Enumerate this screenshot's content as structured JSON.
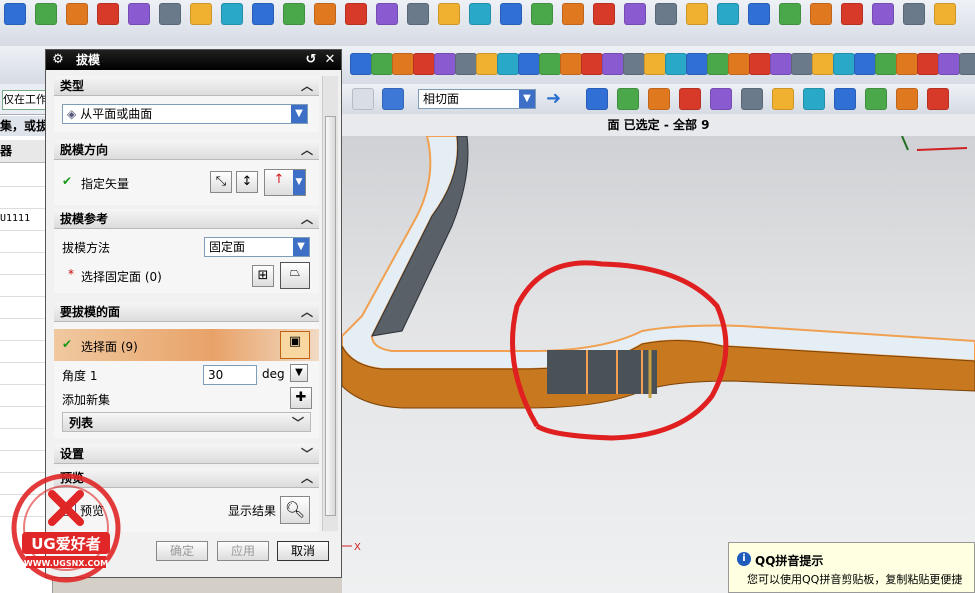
{
  "toolbar": {
    "filter_value": "仅在工作",
    "face_rule_value": "相切面"
  },
  "navigator": {
    "hint_text": "集，或拔",
    "column_header": "器",
    "rows": [
      "",
      "",
      "U1111",
      "",
      "",
      "",
      "",
      "",
      "",
      "",
      "",
      "",
      "",
      "",
      "",
      ""
    ]
  },
  "status": {
    "text": "面 已选定 - 全部 9"
  },
  "dialog": {
    "title": "拔模",
    "sections": {
      "type": {
        "header": "类型",
        "dropdown_value": "从平面或曲面"
      },
      "draw_direction": {
        "header": "脱模方向",
        "specify_vector_label": "指定矢量"
      },
      "draft_reference": {
        "header": "拔模参考",
        "method_label": "拔模方法",
        "method_value": "固定面",
        "select_fixed_label": "选择固定面 (0)"
      },
      "faces_to_draft": {
        "header": "要拔模的面",
        "select_face_label": "选择面 (9)",
        "angle_label": "角度 1",
        "angle_value": "30",
        "angle_unit": "deg",
        "add_new_set_label": "添加新集",
        "list_label": "列表"
      },
      "settings": {
        "header": "设置"
      },
      "preview": {
        "header": "预览",
        "preview_label": "预览",
        "show_result_label": "显示结果"
      }
    },
    "buttons": {
      "ok": "确定",
      "apply": "应用",
      "cancel": "取消"
    }
  },
  "viewport": {
    "axis_x_label": "X"
  },
  "tooltip": {
    "title": "QQ拼音提示",
    "body": "您可以使用QQ拼音剪贴板，复制粘贴更便捷"
  },
  "watermark": {
    "brand": "UG爱好者",
    "url": "WWW.UGSNX.COM"
  },
  "colors": {
    "highlight_orange": "#e8a268",
    "part_orange": "#c8781e",
    "annotation_red": "#e02020"
  }
}
